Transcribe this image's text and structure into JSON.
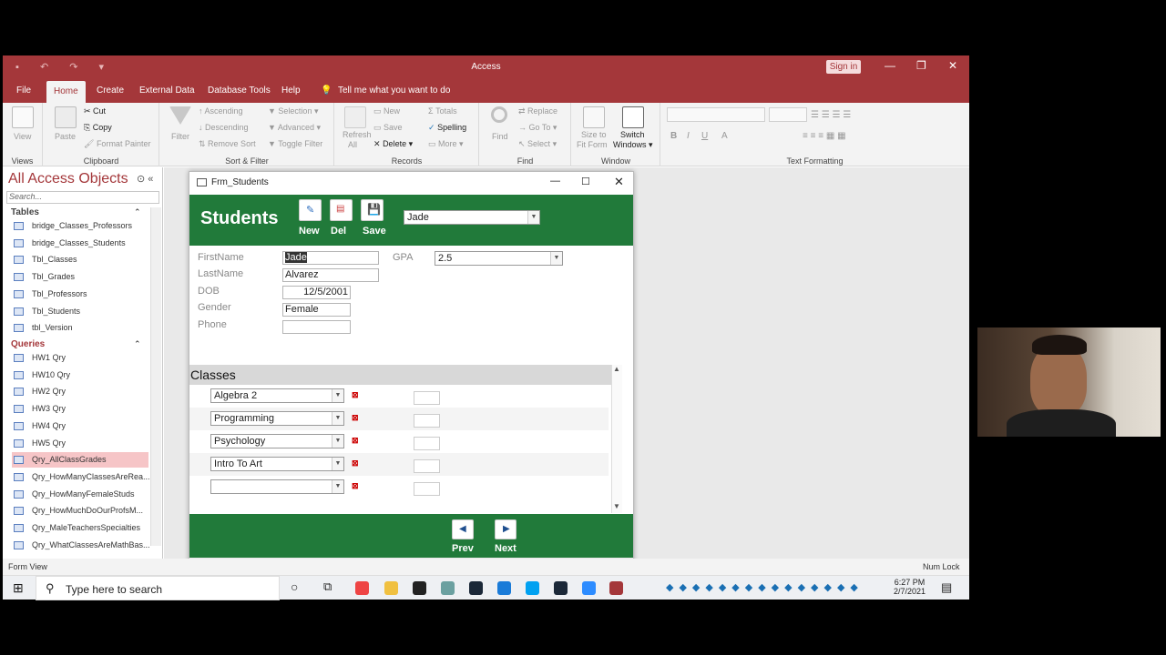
{
  "app": {
    "title": "Access",
    "signin": "Sign in"
  },
  "menu": {
    "tabs": [
      "File",
      "Home",
      "Create",
      "External Data",
      "Database Tools",
      "Help"
    ],
    "tell_me": "Tell me what you want to do"
  },
  "ribbon": {
    "views": {
      "view": "View",
      "label": "Views"
    },
    "clipboard": {
      "paste": "Paste",
      "cut": "Cut",
      "copy": "Copy",
      "format_painter": "Format Painter",
      "label": "Clipboard"
    },
    "sort_filter": {
      "filter": "Filter",
      "ascending": "Ascending",
      "descending": "Descending",
      "remove_sort": "Remove Sort",
      "selection": "Selection",
      "advanced": "Advanced",
      "toggle_filter": "Toggle Filter",
      "label": "Sort & Filter"
    },
    "records": {
      "refresh": "Refresh",
      "refresh2": "All",
      "new": "New",
      "save": "Save",
      "delete": "Delete",
      "totals": "Totals",
      "spelling": "Spelling",
      "more": "More",
      "label": "Records"
    },
    "find": {
      "find": "Find",
      "replace": "Replace",
      "goto": "Go To",
      "select": "Select",
      "label": "Find"
    },
    "window": {
      "size_to_fit": "Size to",
      "size_to_fit2": "Fit Form",
      "switch": "Switch",
      "switch2": "Windows",
      "label": "Window"
    },
    "text_formatting": {
      "label": "Text Formatting",
      "bold": "B",
      "italic": "I",
      "underline": "U",
      "font_color": "A"
    }
  },
  "nav": {
    "title": "All Access Objects",
    "search_placeholder": "Search...",
    "tables_header": "Tables",
    "tables": [
      "bridge_Classes_Professors",
      "bridge_Classes_Students",
      "Tbl_Classes",
      "Tbl_Grades",
      "Tbl_Professors",
      "Tbl_Students",
      "tbl_Version"
    ],
    "queries_header": "Queries",
    "queries": [
      "HW1 Qry",
      "HW10 Qry",
      "HW2 Qry",
      "HW3 Qry",
      "HW4 Qry",
      "HW5 Qry",
      "Qry_AllClassGrades",
      "Qry_HowManyClassesAreRea...",
      "Qry_HowManyFemaleStuds",
      "Qry_HowMuchDoOurProfsM...",
      "Qry_MaleTeachersSpecialties",
      "Qry_WhatClassesAreMathBas..."
    ]
  },
  "form": {
    "window_title": "Frm_Students",
    "heading": "Students",
    "buttons": {
      "new": "New",
      "del": "Del",
      "save": "Save"
    },
    "lookup_value": "Jade",
    "fields": {
      "firstname_label": "FirstName",
      "firstname": "Jade",
      "lastname_label": "LastName",
      "lastname": "Alvarez",
      "dob_label": "DOB",
      "dob": "12/5/2001",
      "gender_label": "Gender",
      "gender": "Female",
      "phone_label": "Phone",
      "phone": "",
      "gpa_label": "GPA",
      "gpa": "2.5"
    },
    "classes_title": "Classes",
    "classes": [
      "Algebra 2",
      "Programming",
      "Psychology",
      "Intro To Art",
      ""
    ],
    "nav": {
      "prev": "Prev",
      "next": "Next"
    }
  },
  "status": {
    "left": "Form View",
    "right": "Num Lock"
  },
  "taskbar": {
    "search_placeholder": "Type here to search",
    "time": "6:27 PM",
    "date": "2/7/2021"
  },
  "colors": {
    "access_red": "#a4373a",
    "form_green": "#217a3a"
  }
}
